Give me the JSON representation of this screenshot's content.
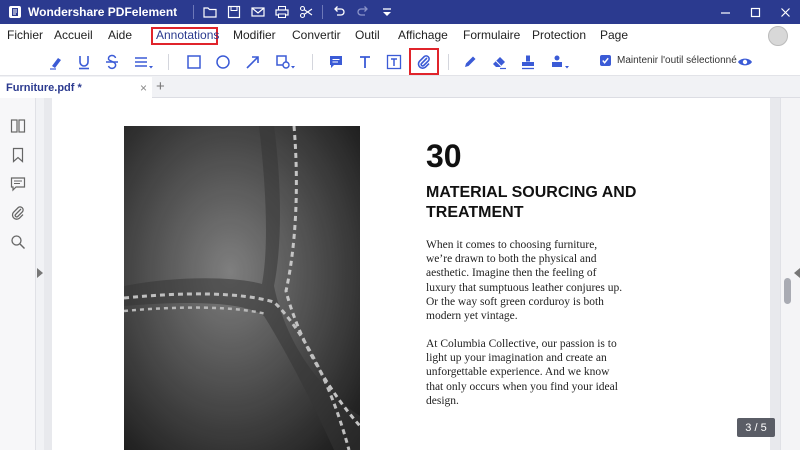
{
  "titlebar": {
    "app_title": "Wondershare PDFelement",
    "bg_color": "#2b3a8f",
    "quick_actions": [
      "folder-icon",
      "save-icon",
      "mail-icon",
      "print-icon",
      "scissors-icon",
      "undo-icon",
      "redo-icon",
      "dropdown-icon"
    ],
    "window_controls": [
      "minimize-icon",
      "maximize-icon",
      "close-icon"
    ]
  },
  "menu": {
    "items": [
      "Fichier",
      "Accueil",
      "Aide",
      "Annotations",
      "Modifier",
      "Convertir",
      "Outil",
      "Affichage",
      "Formulaire",
      "Protection",
      "Page"
    ],
    "active": "Annotations",
    "highlight_color": "#e0242b"
  },
  "toolbar": {
    "tools": [
      "highlight-icon",
      "underline-icon",
      "strikethrough-icon",
      "text-lines-icon",
      "rectangle-icon",
      "circle-icon",
      "arrow-icon",
      "shapes-icon",
      "comment-icon",
      "text-icon",
      "text-box-icon",
      "attachment-icon",
      "pencil-icon",
      "eraser-icon",
      "stamp-icon",
      "signature-stamp-icon",
      "eye-icon"
    ],
    "selected_tool": "attachment-icon",
    "keep_tool_label": "Maintenir l'outil sélectionné",
    "keep_tool_checked": true,
    "accent_color": "#3b5bd6"
  },
  "tabs": {
    "active_tab": "Furniture.pdf *",
    "close_symbol": "×",
    "add_symbol": "+"
  },
  "sidebar": {
    "buttons": [
      "thumbnails-icon",
      "bookmark-icon",
      "comments-icon",
      "attachment-icon",
      "search-icon"
    ]
  },
  "document": {
    "number": "30",
    "heading": "MATERIAL SOURCING AND TREATMENT",
    "paragraph_1": "When it comes to choosing furniture, we’re drawn to both the physical and aesthetic. Imagine then the feeling of luxury that sumptuous leather conjures up. Or the way soft green corduroy is both modern yet vintage.",
    "paragraph_2": "At Columbia Collective, our passion is to light up your imagination and create an unforgettable experience. And we know that only occurs when you find your ideal design.",
    "photo": "leather-texture-photo"
  },
  "status": {
    "page_indicator": "3 / 5"
  }
}
